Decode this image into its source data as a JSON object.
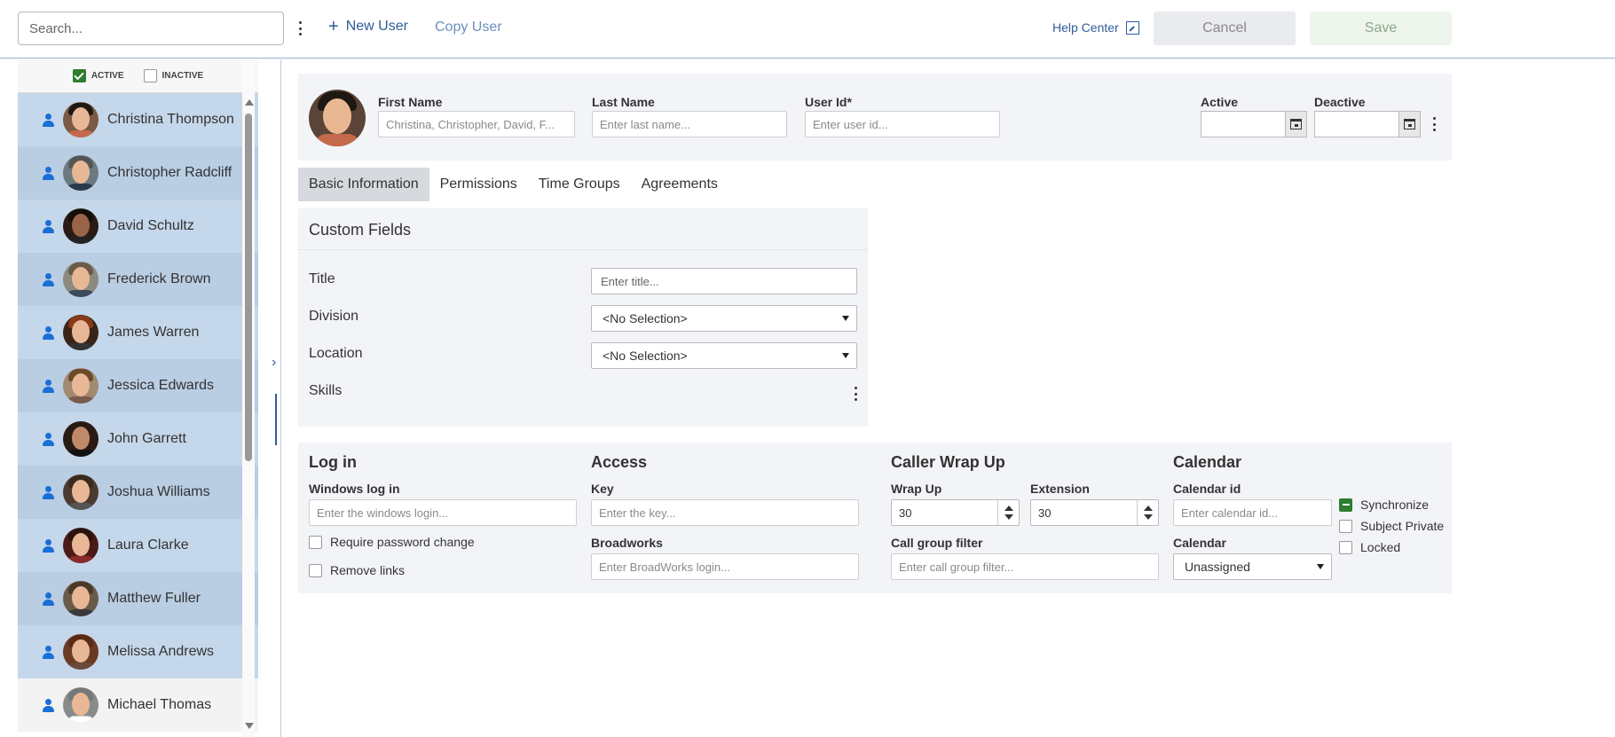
{
  "topbar": {
    "search_placeholder": "Search...",
    "new_user": "New User",
    "copy_user": "Copy User",
    "help_center": "Help Center",
    "cancel": "Cancel",
    "save": "Save"
  },
  "sidebar": {
    "filter_active": "ACTIVE",
    "filter_inactive": "INACTIVE",
    "users": [
      {
        "name": "Christina Thompson"
      },
      {
        "name": "Christopher Radcliff"
      },
      {
        "name": "David Schultz"
      },
      {
        "name": "Frederick Brown"
      },
      {
        "name": "James Warren"
      },
      {
        "name": "Jessica Edwards"
      },
      {
        "name": "John Garrett"
      },
      {
        "name": "Joshua Williams"
      },
      {
        "name": "Laura Clarke"
      },
      {
        "name": "Matthew Fuller"
      },
      {
        "name": "Melissa Andrews"
      },
      {
        "name": "Michael Thomas"
      }
    ]
  },
  "header": {
    "first_name_label": "First Name",
    "first_name_placeholder": "Christina, Christopher, David, F...",
    "last_name_label": "Last Name",
    "last_name_placeholder": "Enter last name...",
    "user_id_label": "User Id*",
    "user_id_placeholder": "Enter user id...",
    "active_label": "Active",
    "deactive_label": "Deactive"
  },
  "tabs": [
    {
      "label": "Basic Information"
    },
    {
      "label": "Permissions"
    },
    {
      "label": "Time Groups"
    },
    {
      "label": "Agreements"
    }
  ],
  "custom_fields": {
    "title": "Custom Fields",
    "title_label": "Title",
    "title_placeholder": "Enter title...",
    "division_label": "Division",
    "division_value": "<No Selection>",
    "location_label": "Location",
    "location_value": "<No Selection>",
    "skills_label": "Skills"
  },
  "login": {
    "title": "Log in",
    "windows_label": "Windows log in",
    "windows_placeholder": "Enter the windows login...",
    "require_password": "Require password change",
    "remove_links": "Remove links"
  },
  "access": {
    "title": "Access",
    "key_label": "Key",
    "key_placeholder": "Enter the key...",
    "broadworks_label": "Broadworks",
    "broadworks_placeholder": "Enter BroadWorks login..."
  },
  "wrapup": {
    "title": "Caller Wrap Up",
    "wrapup_label": "Wrap Up",
    "wrapup_value": "30",
    "extension_label": "Extension",
    "extension_value": "30",
    "call_group_label": "Call group filter",
    "call_group_placeholder": "Enter call group filter..."
  },
  "calendar": {
    "title": "Calendar",
    "calendar_id_label": "Calendar id",
    "calendar_id_placeholder": "Enter calendar id...",
    "calendar_label": "Calendar",
    "calendar_value": "Unassigned",
    "synchronize": "Synchronize",
    "subject_private": "Subject Private",
    "locked": "Locked"
  },
  "colors": {
    "accent": "#2e5c9a",
    "row_highlight": "#c5d7ea",
    "checkbox_active": "#2e7d32"
  }
}
